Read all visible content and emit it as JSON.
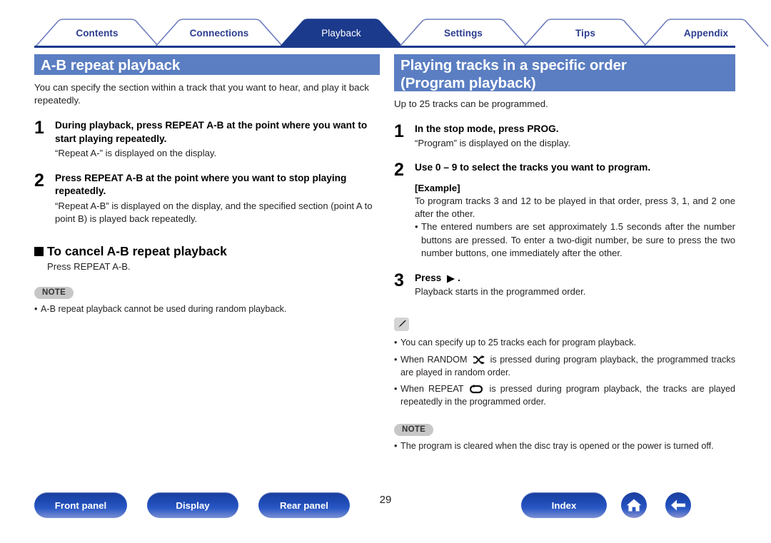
{
  "colors": {
    "tab_active_bg": "#1b3a8c",
    "tab_label": "#2b3d8f",
    "section_head_bg": "#5b7ec2",
    "note_badge_bg": "#c7c7c7",
    "button_blue": "#1f4bb5"
  },
  "tabs": [
    {
      "label": "Contents",
      "active": false
    },
    {
      "label": "Connections",
      "active": false
    },
    {
      "label": "Playback",
      "active": true
    },
    {
      "label": "Settings",
      "active": false
    },
    {
      "label": "Tips",
      "active": false
    },
    {
      "label": "Appendix",
      "active": false
    }
  ],
  "left": {
    "heading": "A-B repeat playback",
    "intro": "You can specify the section within a track that you want to hear, and play it back repeatedly.",
    "steps": [
      {
        "num": "1",
        "title": "During playback, press REPEAT A-B at the point where you want to start playing repeatedly.",
        "sub": "“Repeat A-” is displayed on the display."
      },
      {
        "num": "2",
        "title": "Press REPEAT A-B at the point where you want to stop playing repeatedly.",
        "sub": "“Repeat A-B” is displayed on the display, and the specified section (point A to point B) is played back repeatedly."
      }
    ],
    "subsection": {
      "title": "To cancel A-B repeat playback",
      "body": "Press REPEAT A-B."
    },
    "note": {
      "badge": "NOTE",
      "bullets": [
        "A-B repeat playback cannot be used during random playback."
      ]
    }
  },
  "right": {
    "heading_line1": "Playing tracks in a specific order",
    "heading_line2": "(Program playback)",
    "intro": "Up to 25 tracks can be programmed.",
    "steps": [
      {
        "num": "1",
        "title": "In the stop mode, press PROG.",
        "sub": "“Program” is displayed on the display."
      },
      {
        "num": "2",
        "title": "Use 0 – 9 to select the tracks you want to program.",
        "example_label": "[Example]",
        "example_body": "To program tracks 3 and 12 to be played in that order, press 3, 1, and 2 one after the other.",
        "example_bullet": "The entered numbers are set approximately 1.5 seconds after the number buttons are pressed. To enter a two-digit number, be sure to press the two number buttons, one immediately after the other."
      },
      {
        "num": "3",
        "title_prefix": "Press",
        "title_icon": "play-icon",
        "title_suffix": ".",
        "sub": "Playback starts in the programmed order."
      }
    ],
    "tip": {
      "badge_icon": "pencil-icon",
      "bullets": [
        {
          "before": "You can specify up to 25 tracks each for program playback.",
          "icon": null,
          "after": ""
        },
        {
          "before": "When RANDOM ",
          "icon": "shuffle-icon",
          "after": " is pressed during program playback, the programmed tracks are played in random order."
        },
        {
          "before": "When REPEAT ",
          "icon": "repeat-icon",
          "after": " is pressed during program playback, the tracks are played repeatedly in the programmed order."
        }
      ]
    },
    "note": {
      "badge": "NOTE",
      "bullets": [
        "The program is cleared when the disc tray is opened or the power is turned off."
      ]
    }
  },
  "footer": {
    "buttons": [
      {
        "label": "Front panel"
      },
      {
        "label": "Display"
      },
      {
        "label": "Rear panel"
      },
      {
        "label": "Index"
      }
    ],
    "page_number": "29",
    "home_icon": "home-icon",
    "back_icon": "back-arrow-icon"
  }
}
